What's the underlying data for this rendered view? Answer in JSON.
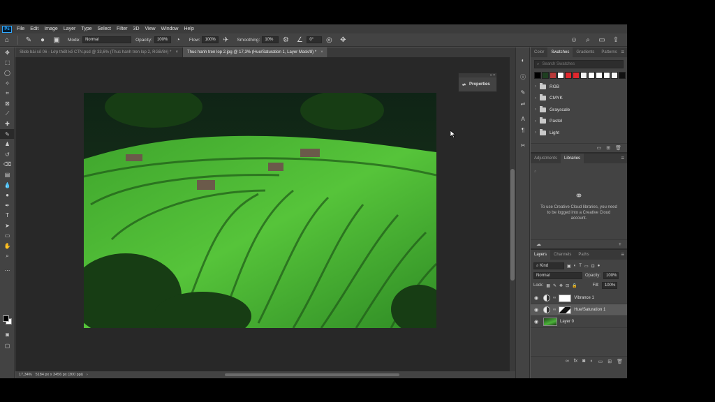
{
  "app": {
    "logo": "Ps",
    "menu": [
      "File",
      "Edit",
      "Image",
      "Layer",
      "Type",
      "Select",
      "Filter",
      "3D",
      "View",
      "Window",
      "Help"
    ]
  },
  "options_bar": {
    "mode_label": "Mode:",
    "mode_value": "Normal",
    "opacity_label": "Opacity:",
    "opacity_value": "100%",
    "flow_label": "Flow:",
    "flow_value": "100%",
    "smoothing_label": "Smoothing:",
    "smoothing_value": "10%",
    "angle_value": "0°"
  },
  "tabs": [
    {
      "label": "Slide bài số 06 - Lớp thiết kế CTN.psd @ 33,6% (Thuc hanh tren lop 2, RGB/8#) *",
      "active": false
    },
    {
      "label": "Thuc hanh tren lop 2.jpg @ 17,3% (Hue/Saturation 1, Layer Mask/8) *",
      "active": true
    }
  ],
  "status": {
    "zoom": "17,34%",
    "doc_size": "5184 px x 3456 px (300 ppi)"
  },
  "properties_panel": {
    "label": "Properties"
  },
  "swatches_panel": {
    "tabs": [
      "Color",
      "Swatches",
      "Gradients",
      "Patterns"
    ],
    "active_tab": "Swatches",
    "search_placeholder": "Search Swatches",
    "colors": [
      "#000000",
      "#1e3f20",
      "#b83a3a",
      "#ffffff",
      "#e0282e",
      "#e0282e",
      "#f2f2f2",
      "#ffffff",
      "#ffffff",
      "#ffffff",
      "#f5f5f5",
      "#111111"
    ],
    "folders": [
      "RGB",
      "CMYK",
      "Grayscale",
      "Pastel",
      "Light"
    ]
  },
  "libraries_panel": {
    "tabs": [
      "Adjustments",
      "Libraries"
    ],
    "active_tab": "Libraries",
    "message": "To use Creative Cloud libraries, you need to be logged into a Creative Cloud account."
  },
  "layers_panel": {
    "tabs": [
      "Layers",
      "Channels",
      "Paths"
    ],
    "active_tab": "Layers",
    "kind_label": "Kind",
    "blend_mode": "Normal",
    "opacity_label": "Opacity:",
    "opacity_value": "100%",
    "lock_label": "Lock:",
    "fill_label": "Fill:",
    "fill_value": "100%",
    "layers": [
      {
        "name": "Vibrance 1",
        "type": "adjustment",
        "selected": false
      },
      {
        "name": "Hue/Saturation 1",
        "type": "adjustment",
        "selected": true
      },
      {
        "name": "Layer 0",
        "type": "image",
        "selected": false
      }
    ]
  }
}
